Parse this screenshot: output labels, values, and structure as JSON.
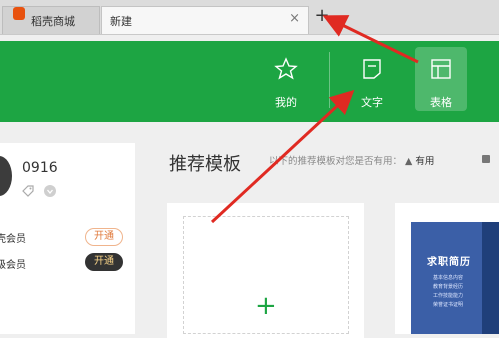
{
  "tabs": [
    {
      "label": "稻壳商城"
    },
    {
      "label": "新建"
    }
  ],
  "new_tab_symbol": "+",
  "close_symbol": "×",
  "header": {
    "buttons": [
      {
        "label": "我的",
        "icon": "star-icon"
      },
      {
        "label": "文字",
        "icon": "document-icon"
      },
      {
        "label": "表格",
        "icon": "table-icon"
      }
    ]
  },
  "user": {
    "name": "0916",
    "membership": [
      {
        "label": "稻壳会员",
        "action": "开通"
      },
      {
        "label": "超级会员",
        "action": "开通"
      }
    ]
  },
  "recommend": {
    "title": "推荐模板",
    "hint": "以下的推荐模板对您是否有用：",
    "useful": "有用"
  },
  "new_card": {
    "symbol": "+"
  },
  "resume_template": {
    "title": "求职简历",
    "lines": [
      "基本信息内容",
      "教育背景经历",
      "工作技能能力",
      "荣誉证书证明"
    ]
  },
  "colors": {
    "brand_green": "#1da543",
    "annotation_red": "#e02a22"
  }
}
